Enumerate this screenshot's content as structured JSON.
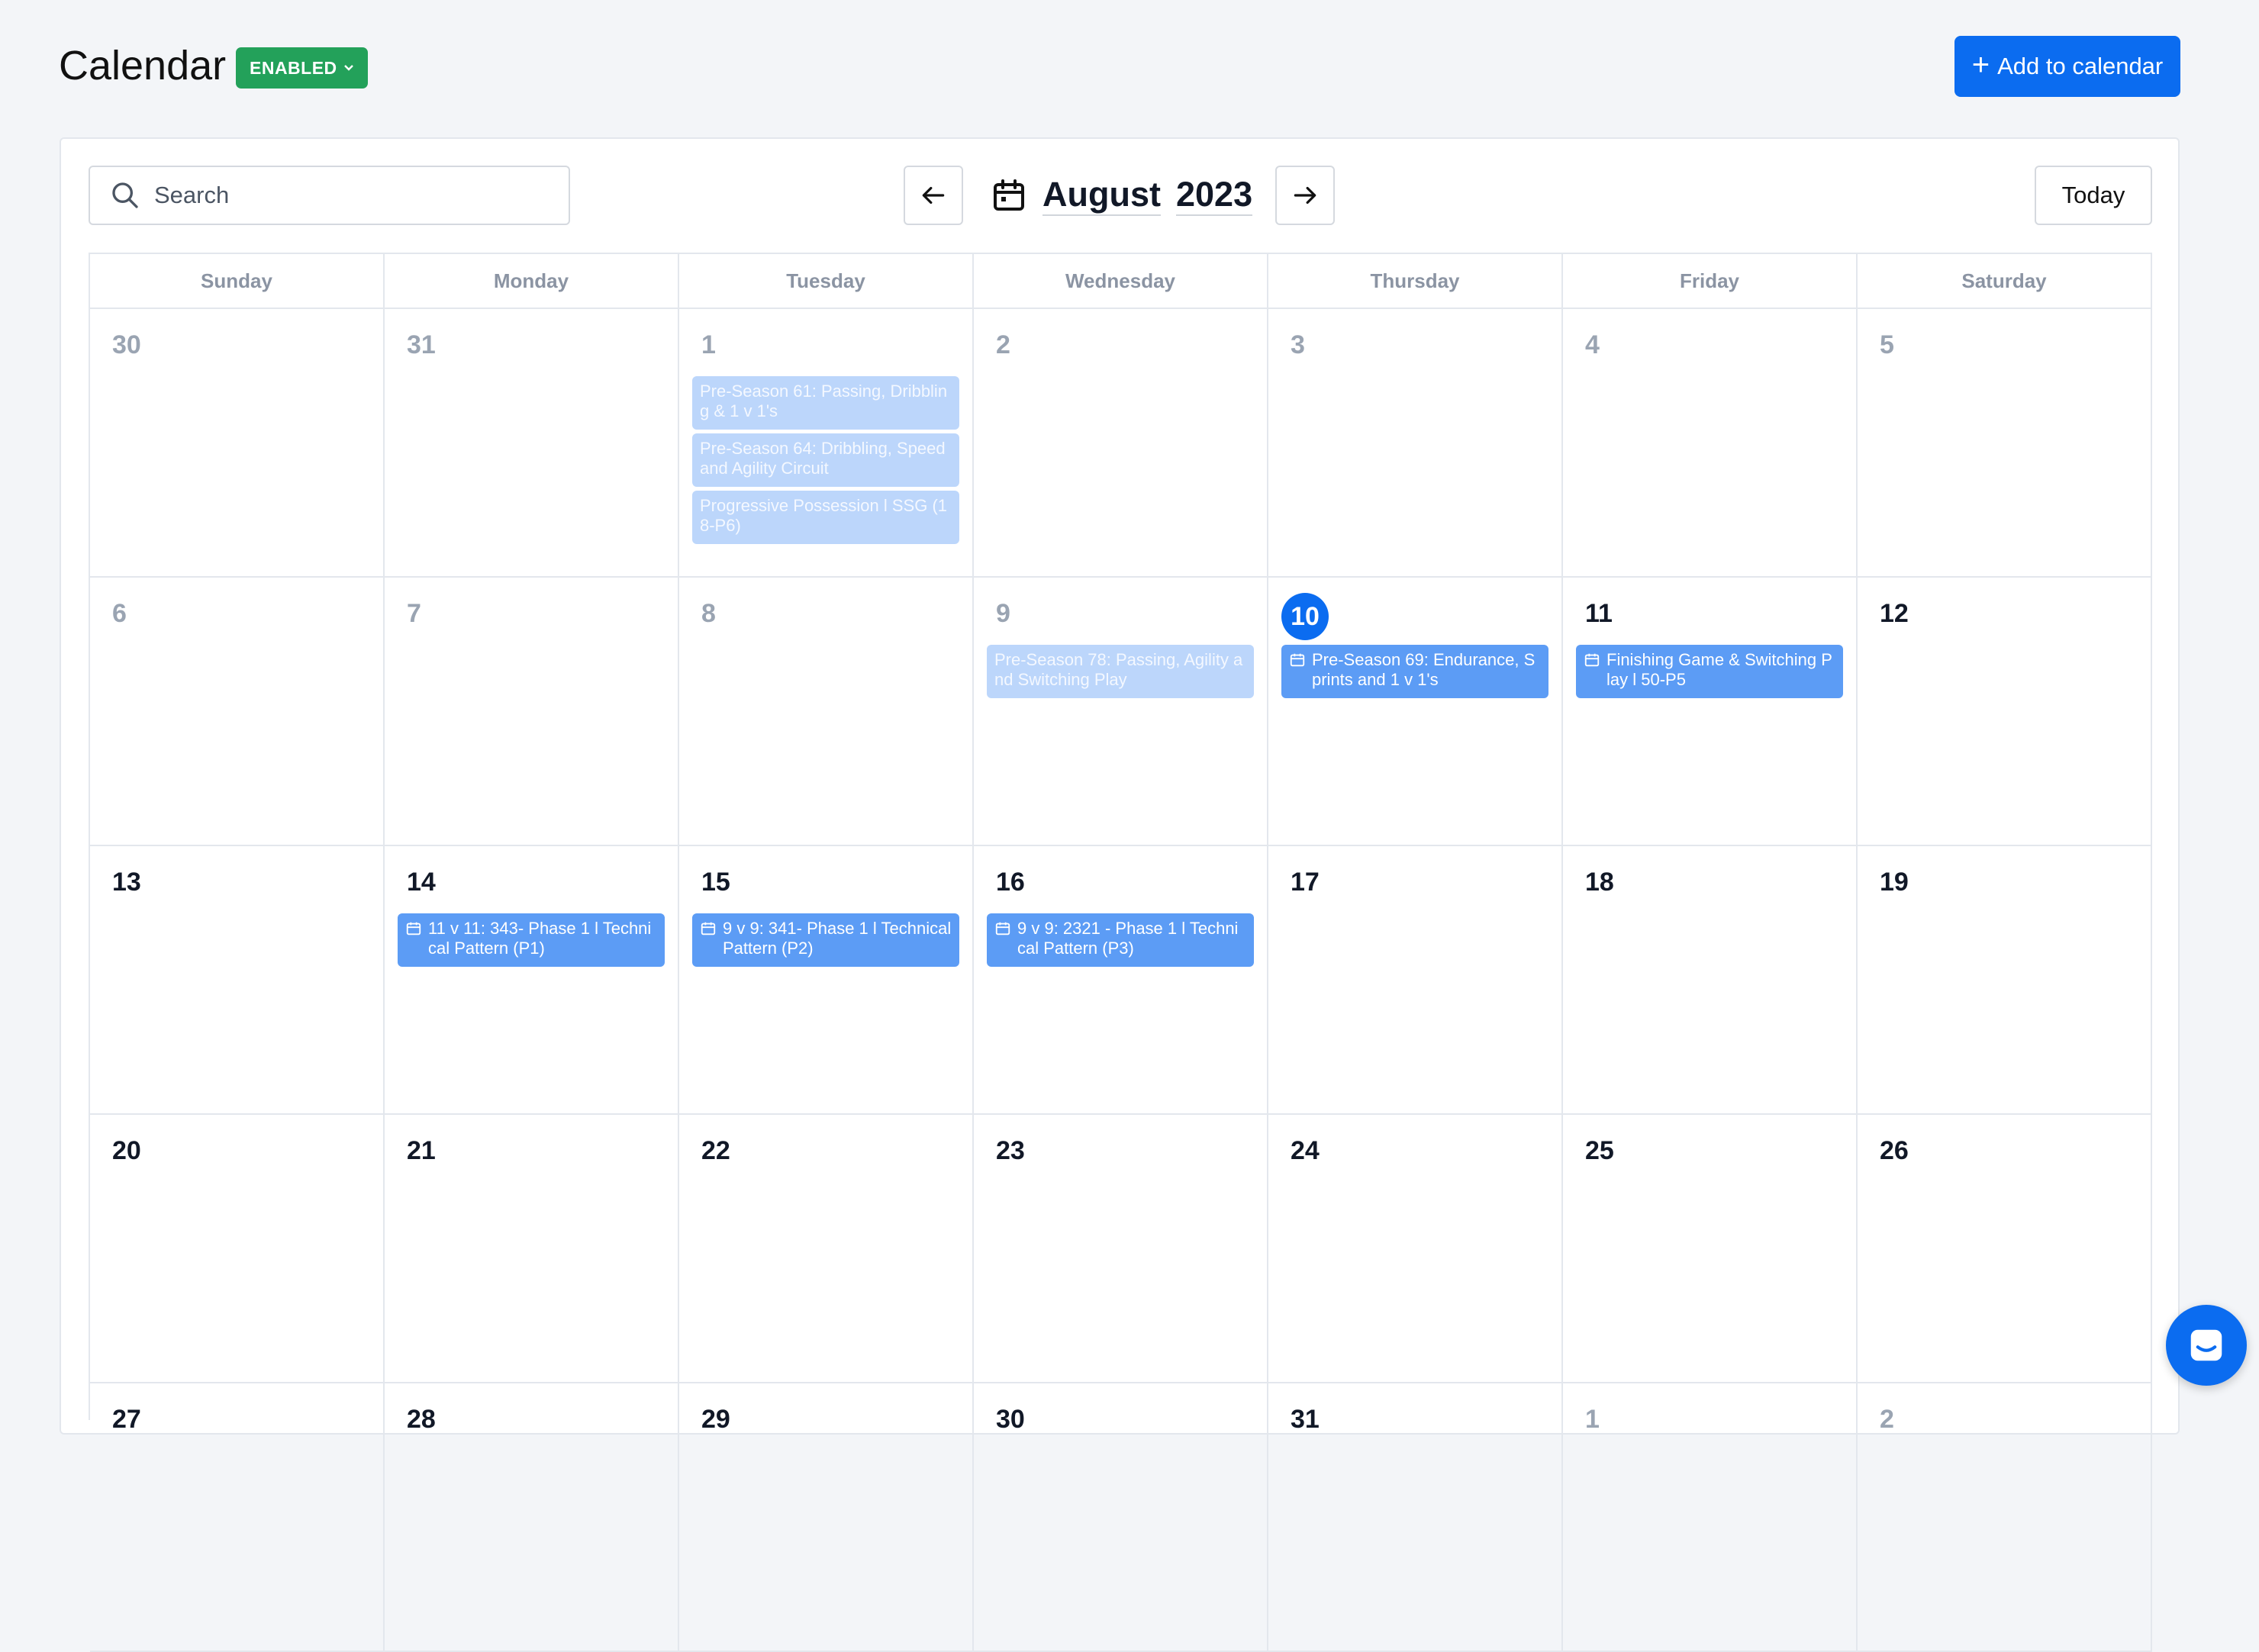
{
  "header": {
    "title": "Calendar",
    "status": "ENABLED",
    "add_button": "Add to calendar"
  },
  "toolbar": {
    "search_placeholder": "Search",
    "month": "August",
    "year": "2023",
    "today_button": "Today"
  },
  "weekdays": [
    "Sunday",
    "Monday",
    "Tuesday",
    "Wednesday",
    "Thursday",
    "Friday",
    "Saturday"
  ],
  "weeks": [
    [
      {
        "day": "30",
        "past": true,
        "events": []
      },
      {
        "day": "31",
        "past": true,
        "events": []
      },
      {
        "day": "1",
        "past": true,
        "events": [
          {
            "title": "Pre-Season 61: Passing, Dribbling & 1 v 1's",
            "style": "faded"
          },
          {
            "title": "Pre-Season 64: Dribbling, Speed and Agility Circuit",
            "style": "faded"
          },
          {
            "title": "Progressive Possession l SSG (18-P6)",
            "style": "faded"
          }
        ]
      },
      {
        "day": "2",
        "past": true,
        "events": []
      },
      {
        "day": "3",
        "past": true,
        "events": []
      },
      {
        "day": "4",
        "past": true,
        "events": []
      },
      {
        "day": "5",
        "past": true,
        "events": []
      }
    ],
    [
      {
        "day": "6",
        "past": true,
        "events": []
      },
      {
        "day": "7",
        "past": true,
        "events": []
      },
      {
        "day": "8",
        "past": true,
        "events": []
      },
      {
        "day": "9",
        "past": true,
        "events": [
          {
            "title": "Pre-Season 78: Passing, Agility and Switching Play",
            "style": "faded"
          }
        ]
      },
      {
        "day": "10",
        "today": true,
        "events": [
          {
            "title": "Pre-Season 69: Endurance, Sprints and 1 v 1's",
            "style": "active",
            "icon": true
          }
        ]
      },
      {
        "day": "11",
        "events": [
          {
            "title": "Finishing Game & Switching Play l 50-P5",
            "style": "active",
            "icon": true
          }
        ]
      },
      {
        "day": "12",
        "events": []
      }
    ],
    [
      {
        "day": "13",
        "events": []
      },
      {
        "day": "14",
        "events": [
          {
            "title": "11 v 11: 343- Phase 1 l Technical Pattern (P1)",
            "style": "active",
            "icon": true
          }
        ]
      },
      {
        "day": "15",
        "events": [
          {
            "title": "9 v 9: 341- Phase 1 l Technical Pattern (P2)",
            "style": "active",
            "icon": true
          }
        ]
      },
      {
        "day": "16",
        "events": [
          {
            "title": "9 v 9: 2321 - Phase 1 l Technical Pattern (P3)",
            "style": "active",
            "icon": true
          }
        ]
      },
      {
        "day": "17",
        "events": []
      },
      {
        "day": "18",
        "events": []
      },
      {
        "day": "19",
        "events": []
      }
    ],
    [
      {
        "day": "20",
        "events": []
      },
      {
        "day": "21",
        "events": []
      },
      {
        "day": "22",
        "events": []
      },
      {
        "day": "23",
        "events": []
      },
      {
        "day": "24",
        "events": []
      },
      {
        "day": "25",
        "events": []
      },
      {
        "day": "26",
        "events": []
      }
    ],
    [
      {
        "day": "27",
        "events": []
      },
      {
        "day": "28",
        "events": []
      },
      {
        "day": "29",
        "events": []
      },
      {
        "day": "30",
        "events": []
      },
      {
        "day": "31",
        "events": []
      },
      {
        "day": "1",
        "past": true,
        "events": []
      },
      {
        "day": "2",
        "past": true,
        "events": []
      }
    ]
  ],
  "colors": {
    "accent": "#0b6cf0",
    "enabled_badge": "#23a15a",
    "event_active": "#5c9cf5",
    "event_faded": "#bcd6fb"
  }
}
